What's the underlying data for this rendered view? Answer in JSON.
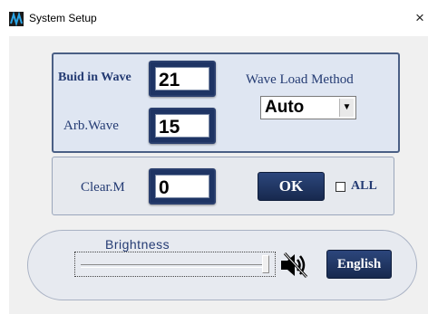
{
  "window": {
    "title": "System Setup",
    "close_symbol": "×",
    "icon": "app-logo-icon"
  },
  "wave": {
    "built_in_label": "Buid in Wave",
    "built_in_value": "21",
    "arb_label": "Arb.Wave",
    "arb_value": "15",
    "load_method_label": "Wave Load Method",
    "load_method_value": "Auto",
    "dropdown_arrow": "▼"
  },
  "clear": {
    "label": "Clear.M",
    "value": "0",
    "ok_label": "OK",
    "all_label": "ALL",
    "all_checked": false
  },
  "display": {
    "brightness_label": "Brightness",
    "brightness_level": 1.0,
    "mute_icon": "speaker-muted-icon",
    "language_button": "English"
  },
  "colors": {
    "accent": "#1e3464",
    "label_text": "#243b73",
    "panel_bg": "#dfe6f2"
  }
}
